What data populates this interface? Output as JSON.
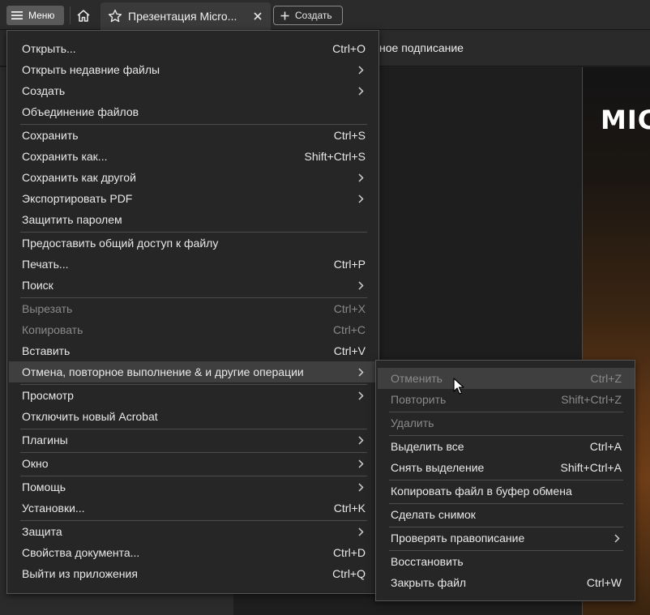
{
  "header": {
    "menu_label": "Меню",
    "tab_title": "Презентация Micro...",
    "new_tab_label": "Создать"
  },
  "toolbar": {
    "visible_text": "ное подписание"
  },
  "document": {
    "visible_title": "MIC"
  },
  "main_menu": {
    "items": [
      {
        "label": "Открыть...",
        "shortcut": "Ctrl+O"
      },
      {
        "label": "Открыть недавние файлы"
      },
      {
        "label": "Создать"
      },
      {
        "label": "Объединение файлов"
      },
      {
        "label": "Сохранить",
        "shortcut": "Ctrl+S"
      },
      {
        "label": "Сохранить как...",
        "shortcut": "Shift+Ctrl+S"
      },
      {
        "label": "Сохранить как другой"
      },
      {
        "label": "Экспортировать PDF"
      },
      {
        "label": "Защитить паролем"
      },
      {
        "label": "Предоставить общий доступ к файлу"
      },
      {
        "label": "Печать...",
        "shortcut": "Ctrl+P"
      },
      {
        "label": "Поиск"
      },
      {
        "label": "Вырезать",
        "shortcut": "Ctrl+X",
        "disabled": true
      },
      {
        "label": "Копировать",
        "shortcut": "Ctrl+C",
        "disabled": true
      },
      {
        "label": "Вставить",
        "shortcut": "Ctrl+V"
      },
      {
        "label": "Отмена, повторное выполнение & и другие операции",
        "highlighted": true
      },
      {
        "label": "Просмотр"
      },
      {
        "label": "Отключить новый Acrobat"
      },
      {
        "label": "Плагины"
      },
      {
        "label": "Окно"
      },
      {
        "label": "Помощь"
      },
      {
        "label": "Установки...",
        "shortcut": "Ctrl+K"
      },
      {
        "label": "Защита"
      },
      {
        "label": "Свойства документа...",
        "shortcut": "Ctrl+D"
      },
      {
        "label": "Выйти из приложения",
        "shortcut": "Ctrl+Q"
      }
    ]
  },
  "submenu": {
    "items": [
      {
        "label": "Отменить",
        "shortcut": "Ctrl+Z",
        "disabled": true,
        "hovered": true
      },
      {
        "label": "Повторить",
        "shortcut": "Shift+Ctrl+Z",
        "disabled": true
      },
      {
        "label": "Удалить",
        "disabled": true
      },
      {
        "label": "Выделить все",
        "shortcut": "Ctrl+A"
      },
      {
        "label": "Снять выделение",
        "shortcut": "Shift+Ctrl+A"
      },
      {
        "label": "Копировать файл в буфер обмена"
      },
      {
        "label": "Сделать снимок"
      },
      {
        "label": "Проверять правописание"
      },
      {
        "label": "Восстановить"
      },
      {
        "label": "Закрыть файл",
        "shortcut": "Ctrl+W"
      }
    ]
  },
  "colors": {
    "menu_bg": "#262626",
    "highlight": "#3f3f3f",
    "disabled_text": "#8a8a8a"
  }
}
